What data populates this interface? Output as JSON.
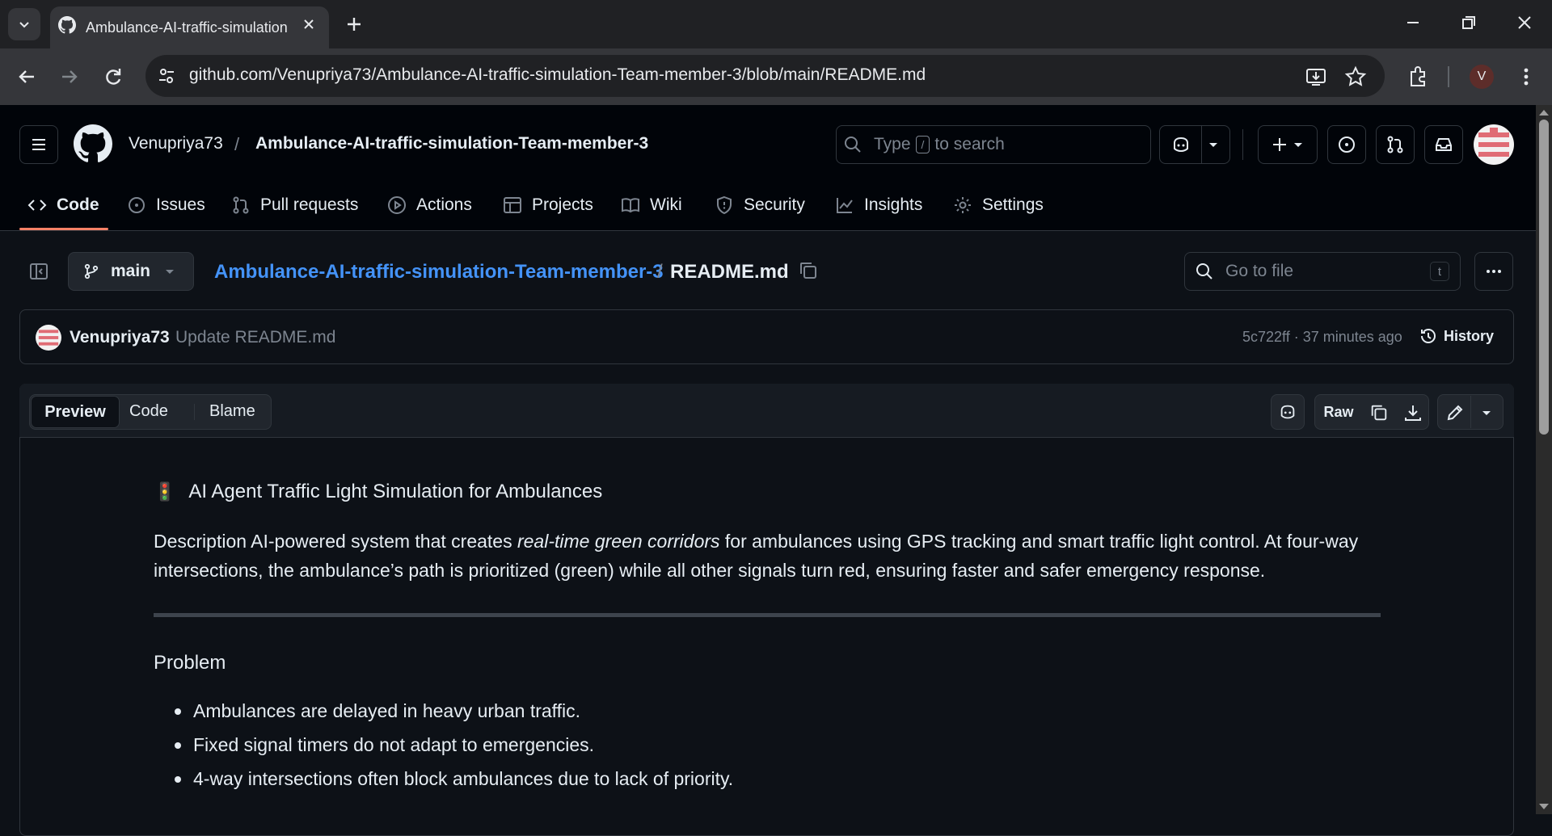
{
  "browser": {
    "tab_title": "Ambulance-AI-traffic-simulation",
    "url": "github.com/Venupriya73/Ambulance-AI-traffic-simulation-Team-member-3/blob/main/README.md",
    "profile_initial": "V"
  },
  "header": {
    "owner": "Venupriya73",
    "separator": "/",
    "repo": "Ambulance-AI-traffic-simulation-Team-member-3",
    "search_prefix": "Type",
    "search_key": "/",
    "search_suffix": "to search"
  },
  "repo_tabs": [
    {
      "label": "Code",
      "icon": "code-icon"
    },
    {
      "label": "Issues",
      "icon": "issue-icon"
    },
    {
      "label": "Pull requests",
      "icon": "pull-request-icon"
    },
    {
      "label": "Actions",
      "icon": "play-icon"
    },
    {
      "label": "Projects",
      "icon": "table-icon"
    },
    {
      "label": "Wiki",
      "icon": "book-icon"
    },
    {
      "label": "Security",
      "icon": "shield-icon"
    },
    {
      "label": "Insights",
      "icon": "graph-icon"
    },
    {
      "label": "Settings",
      "icon": "gear-icon"
    }
  ],
  "file_nav": {
    "branch": "main",
    "crumb_repo": "Ambulance-AI-traffic-simulation-Team-member-3",
    "crumb_sep": "/",
    "crumb_file": "README.md",
    "goto_placeholder": "Go to file",
    "goto_key": "t"
  },
  "commit": {
    "author": "Venupriya73",
    "message": "Update README.md",
    "meta": "5c722ff · 37 minutes ago",
    "history_label": "History"
  },
  "file_toolbar": {
    "preview": "Preview",
    "code": "Code",
    "blame": "Blame",
    "raw": "Raw"
  },
  "readme": {
    "title_emoji": "🚦",
    "title": "AI Agent Traffic Light Simulation for Ambulances",
    "desc_before": "Description AI-powered system that creates ",
    "desc_em": "real-time green corridors",
    "desc_after": " for ambulances using GPS tracking and smart traffic light control. At four-way intersections, the ambulance’s path is prioritized (green) while all other signals turn red, ensuring faster and safer emergency response.",
    "problem_heading": "Problem",
    "problems": [
      "Ambulances are delayed in heavy urban traffic.",
      "Fixed signal timers do not adapt to emergencies.",
      "4-way intersections often block ambulances due to lack of priority."
    ]
  },
  "colors": {
    "link": "#4493f8",
    "tab_underline": "#f78166",
    "bg": "#0d1117"
  }
}
